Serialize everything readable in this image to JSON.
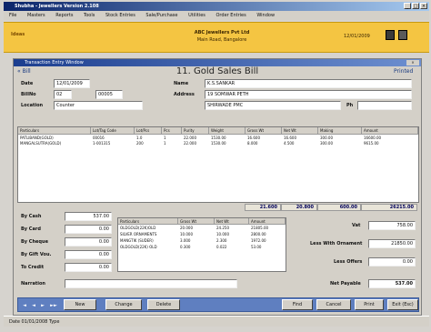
{
  "app": {
    "title": "Shubha - Jewellers Version 2.108"
  },
  "menu": [
    "File",
    "Masters",
    "Reports",
    "Tools",
    "Stock Entries",
    "Sale/Purchase",
    "Utilities",
    "Order Entries",
    "Window"
  ],
  "brand": {
    "company": "ABC Jewellers Pvt Ltd",
    "address": "Main Road, Bangalore",
    "date": "12/01/2009"
  },
  "window": {
    "title": "Transaction Entry Window",
    "heading": "11. Gold Sales Bill",
    "left_tag": "« Bill",
    "right_tag": "Printed"
  },
  "form": {
    "date_label": "Date",
    "date_value": "12/01/2009",
    "bill_label": "BillNo",
    "bill_prefix": "02",
    "bill_value": "00005",
    "location_label": "Location",
    "location_value": "Counter",
    "name_label": "Name",
    "name_value": "K.S.SANKAR",
    "address_label": "Address",
    "address_1": "19 SOMWAR PETH",
    "address_2": "SHIRWADE PMC",
    "ph_label": "Ph"
  },
  "items": {
    "headers": [
      "Particulars",
      "Lot/Tag Code",
      "Lot/Pcs",
      "Pcs",
      "Purity",
      "Weight",
      "Gross Wt",
      "Net Wt",
      "Making",
      "Amount"
    ],
    "rows": [
      [
        "PATLIBAND(GOLD)",
        "00016",
        "1.0",
        "1",
        "22.000",
        "1530.00",
        "16.600",
        "16.600",
        "300.00",
        "16600.00"
      ],
      [
        "MANGALSUTRA(GOLD)",
        "1-001315",
        "200",
        "1",
        "22.000",
        "1530.00",
        "8.000",
        "4.500",
        "300.00",
        "9615.00"
      ]
    ],
    "totals": [
      "21.600",
      "20.800",
      "600.00",
      "26215.00"
    ]
  },
  "payment": {
    "cash_label": "By Cash",
    "cash_value": "537.00",
    "card_label": "By Card",
    "card_value": "0.00",
    "cheque_label": "By Cheque",
    "cheque_value": "0.00",
    "giftvou_label": "By Gift Vou.",
    "giftvou_value": "0.00",
    "credit_label": "To Credit",
    "credit_value": "0.00",
    "narration_label": "Narration",
    "narration_value": ""
  },
  "oldgold": {
    "headers": [
      "Particulars",
      "Gross Wt",
      "Net Wt",
      "Amount"
    ],
    "rows": [
      [
        "OLDGOLD(22K)OLD",
        "20.000",
        "24.250",
        "21805.00"
      ],
      [
        "SILVER ORNAMENTS",
        "10.000",
        "10.000",
        "2800.00"
      ],
      [
        "MANGTIK (SUDER)",
        "3.000",
        "2.300",
        "1972.00"
      ],
      [
        "OLDGOLD(22K) OLD",
        "0.300",
        "0.022",
        "53.00"
      ]
    ]
  },
  "summary": {
    "vat_label": "Vat",
    "vat_value": "758.00",
    "lessold_label": "Less With Ornament",
    "lessold_value": "21850.00",
    "lessoffer_label": "Less Offers",
    "lessoffer_value": "0.00",
    "netpay_label": "Net Payable",
    "netpay_value": "537.00"
  },
  "toolbar": {
    "nav": [
      "◄",
      "◄",
      "►",
      "►►"
    ],
    "new_label": "New",
    "change_label": "Change",
    "delete_label": "Delete",
    "find_label": "Find",
    "cancel_label": "Cancel",
    "print_label": "Print",
    "exit_label": "Exit (Esc)"
  },
  "status": {
    "text": "Date 01/01/2008 Type"
  }
}
